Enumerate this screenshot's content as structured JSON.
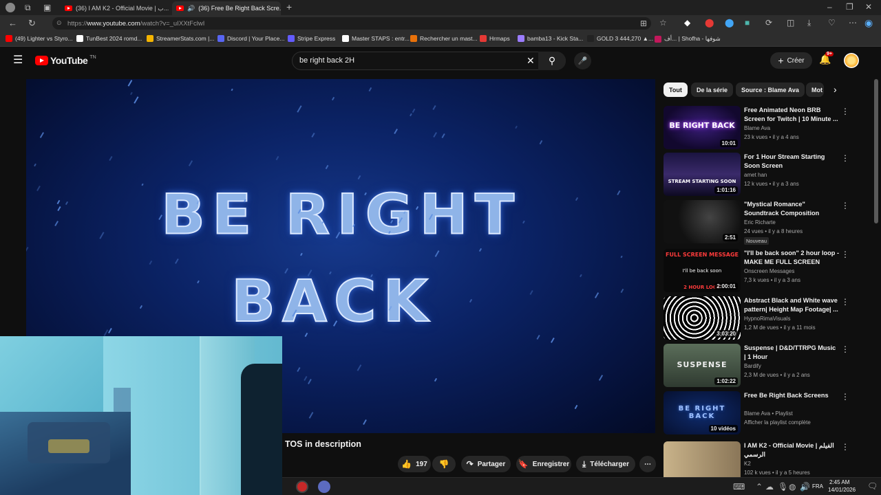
{
  "browser": {
    "tabs": [
      {
        "label": "(36) I AM K2 - Official Movie | ب..."
      },
      {
        "label": "(36) Free Be Right Back Scre..."
      }
    ],
    "address": {
      "prefix": "https://",
      "host": "www.youtube.com",
      "path": "/watch?v=_uIXXtFclwI"
    },
    "bookmarks": [
      {
        "label": "(49) Lighter vs Styro...",
        "color": "#ff0000"
      },
      {
        "label": "TunBest 2024 romd...",
        "color": "#ffffff"
      },
      {
        "label": "StreamerStats.com |...",
        "color": "#f4b400"
      },
      {
        "label": "Discord | Your Place...",
        "color": "#5865f2"
      },
      {
        "label": "Stripe Express",
        "color": "#635bff"
      },
      {
        "label": "Master STAPS : entr...",
        "color": "#ffffff"
      },
      {
        "label": "Rechercher un mast...",
        "color": "#e8710a"
      },
      {
        "label": "Hrmaps",
        "color": "#e53935"
      },
      {
        "label": "bamba13 - Kick Sta...",
        "color": "#9b7cff"
      },
      {
        "label": "GOLD 3 444,270 ▲...",
        "color": "#222222"
      },
      {
        "label": "أف... | Shofha - شوفها",
        "color": "#c2185b"
      }
    ]
  },
  "youtube": {
    "logo": "YouTube",
    "logo_sup": "TN",
    "search_query": "be right back 2H",
    "create_label": "Créer",
    "notif_count": "9+"
  },
  "player": {
    "line1": "BE RIGHT",
    "line2": "BACK",
    "title_partial": "TOS in description",
    "likes": "197",
    "share": "Partager",
    "save": "Enregistrer",
    "download": "Télécharger"
  },
  "chips": [
    {
      "label": "Tout"
    },
    {
      "label": "De la série"
    },
    {
      "label": "Source : Blame Ava"
    },
    {
      "label": "Mot"
    }
  ],
  "recommendations": [
    {
      "title": "Free Animated Neon BRB Screen for Twitch | 10 Minute ...",
      "channel": "Blame Ava",
      "meta": "23 k vues • il y a 4 ans",
      "duration": "10:01",
      "thumb_text": "BE RIGHT BACK"
    },
    {
      "title": "For 1 Hour Stream Starting Soon Screen",
      "channel": "amet han",
      "meta": "12 k vues • il y a 3 ans",
      "duration": "1:01:16",
      "thumb_text": "STREAM STARTING SOON"
    },
    {
      "title": "\"Mystical Romance\" Soundtrack Composition",
      "channel": "Eric Richarte",
      "meta": "24 vues • il y a 8 heures",
      "duration": "2:51",
      "badge": "Nouveau"
    },
    {
      "title": "\"I'll be back soon\" 2 hour loop - MAKE ME FULL SCREEN",
      "channel": "Onscreen Messages",
      "meta": "7,3 k vues • il y a 3 ans",
      "duration": "2:00:01",
      "thumb_text": "FULL SCREEN MESSAGE",
      "thumb_text2": "I'll be back soon",
      "thumb_text3": "2 HOUR LOOP"
    },
    {
      "title": "Abstract Black and White wave pattern| Height Map Footage| ...",
      "channel": "HypnoRimaVisuals",
      "meta": "1,2 M de vues • il y a 11 mois",
      "duration": "3:03:20"
    },
    {
      "title": "Suspense | D&D/TTRPG Music | 1 Hour",
      "channel": "Bardify",
      "meta": "2,3 M de vues • il y a 2 ans",
      "duration": "1:02:22",
      "thumb_text": "SUSPENSE"
    },
    {
      "title": "Free Be Right Back Screens",
      "channel": "Blame Ava • Playlist",
      "meta": "Afficher la playlist complète",
      "duration": "10 vidéos",
      "thumb_text": "BE RIGHT BACK"
    },
    {
      "title": "I AM K2 - Official Movie | الفيلم الرسمي",
      "channel": "K2",
      "meta": "102 k vues • il y a 5 heures",
      "duration": ""
    }
  ],
  "taskbar": {
    "lang": "FRA",
    "time": "2:45 AM",
    "date": "14/01/2026"
  }
}
